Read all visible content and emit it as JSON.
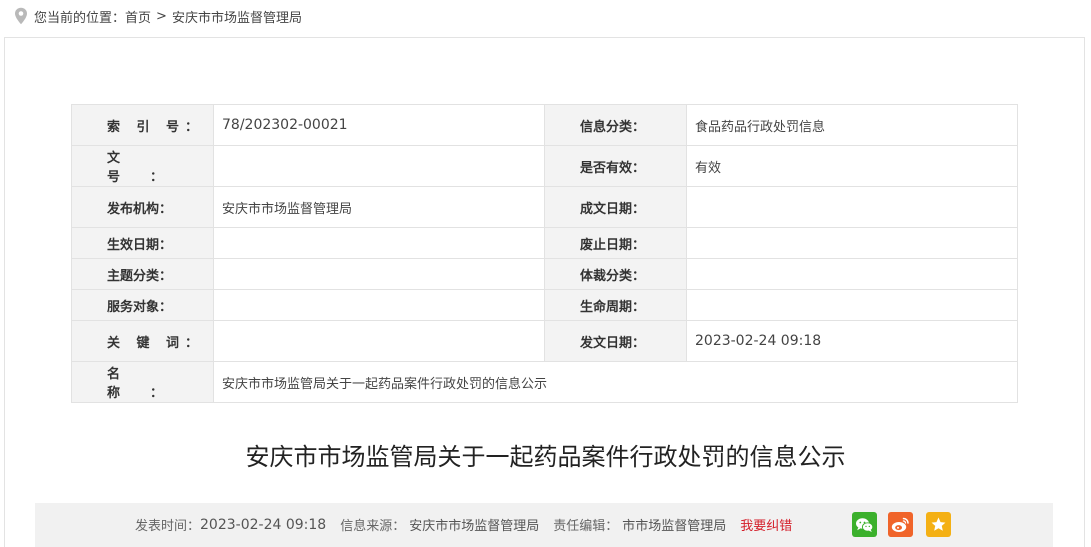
{
  "breadcrumb": {
    "prefix": "您当前的位置：",
    "home": "首页",
    "separator": ">",
    "current": "安庆市市场监督管理局"
  },
  "meta_table": {
    "rows": [
      [
        {
          "label": "索 引 号：",
          "value": "78/202302-00021"
        },
        {
          "label": "信息分类：",
          "value": "食品药品行政处罚信息"
        }
      ],
      [
        {
          "label": "文 号：",
          "value": ""
        },
        {
          "label": "是否有效：",
          "value": "有效"
        }
      ],
      [
        {
          "label": "发布机构：",
          "value": "安庆市市场监督管理局"
        },
        {
          "label": "成文日期：",
          "value": ""
        }
      ],
      [
        {
          "label": "生效日期：",
          "value": ""
        },
        {
          "label": "废止日期：",
          "value": ""
        }
      ],
      [
        {
          "label": "主题分类：",
          "value": ""
        },
        {
          "label": "体裁分类：",
          "value": ""
        }
      ],
      [
        {
          "label": "服务对象：",
          "value": ""
        },
        {
          "label": "生命周期：",
          "value": ""
        }
      ],
      [
        {
          "label": "关 键 词：",
          "value": ""
        },
        {
          "label": "发文日期：",
          "value": "2023-02-24 09:18"
        }
      ]
    ],
    "name_row": {
      "label": "名 称：",
      "value": "安庆市市场监管局关于一起药品案件行政处罚的信息公示"
    }
  },
  "article": {
    "title": "安庆市市场监管局关于一起药品案件行政处罚的信息公示"
  },
  "info_bar": {
    "publish_label": "发表时间：",
    "publish_time": "2023-02-24 09:18",
    "source_label": "信息来源：",
    "source": "安庆市市场监督管理局",
    "editor_label": "责任编辑：",
    "editor": "市市场监督管理局",
    "report_link": "我要纠错",
    "share_icons": [
      "wechat-icon",
      "weibo-icon",
      "favorite-star-icon"
    ]
  },
  "colors": {
    "label_bg": "#f3f3f3",
    "border": "#e2e2e2",
    "info_bar_bg": "#f1f1f1",
    "report_red": "#d4202b",
    "wechat_green": "#3bb02c",
    "weibo_orange": "#f0642a",
    "favorite_yellow": "#f4b014"
  }
}
